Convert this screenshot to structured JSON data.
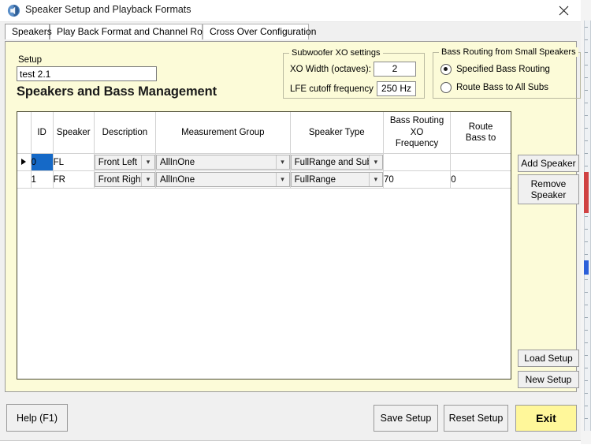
{
  "window": {
    "title": "Speaker Setup and Playback Formats",
    "app_icon": "speaker-app-icon",
    "close_label": "✕"
  },
  "tabs": [
    {
      "label": "Speakers",
      "active": true
    },
    {
      "label": "Play Back Format and Channel Routing",
      "active": false
    },
    {
      "label": "Cross Over Configuration",
      "active": false
    }
  ],
  "setup": {
    "label": "Setup",
    "value": "test 2.1",
    "placeholder": "",
    "heading": "Speakers and Bass Management"
  },
  "subwoofer_xo": {
    "title": "Subwoofer XO settings",
    "xo_width_label": "XO Width (octaves):",
    "xo_width_value": "2",
    "lfe_cutoff_label": "LFE cutoff frequency",
    "lfe_cutoff_value": "250 Hz"
  },
  "bass_routing": {
    "title": "Bass Routing from Small Speakers",
    "options": [
      {
        "label": "Specified Bass Routing",
        "checked": true
      },
      {
        "label": "Route Bass to All Subs",
        "checked": false
      }
    ]
  },
  "grid": {
    "columns": [
      "ID",
      "Speaker",
      "Description",
      "Measurement Group",
      "Speaker Type",
      "Bass Routing\nXO\nFrequency",
      "Route\nBass to"
    ],
    "rows": [
      {
        "current": true,
        "id": "0",
        "id_selected": true,
        "speaker": "FL",
        "description": "Front Left",
        "measurement_group": "AllInOne",
        "speaker_type": "FullRange and Sub",
        "bass_routing_xo_frequency": "",
        "route_bass_to": ""
      },
      {
        "current": false,
        "id": "1",
        "id_selected": false,
        "speaker": "FR",
        "description": "Front Right",
        "measurement_group": "AllInOne",
        "speaker_type": "FullRange",
        "bass_routing_xo_frequency": "70",
        "route_bass_to": "0"
      }
    ]
  },
  "side_buttons": {
    "add_speaker": "Add Speaker",
    "remove_speaker": "Remove\nSpeaker",
    "load_setup": "Load Setup",
    "new_setup": "New Setup"
  },
  "bottom_buttons": {
    "help": "Help (F1)",
    "save_setup": "Save Setup",
    "reset_setup": "Reset Setup",
    "exit": "Exit"
  },
  "colors": {
    "panel_background": "#fcfbd8",
    "selection_blue": "#1569c7",
    "exit_yellow": "#fff79a",
    "window_chrome": "#f0f0f0"
  }
}
